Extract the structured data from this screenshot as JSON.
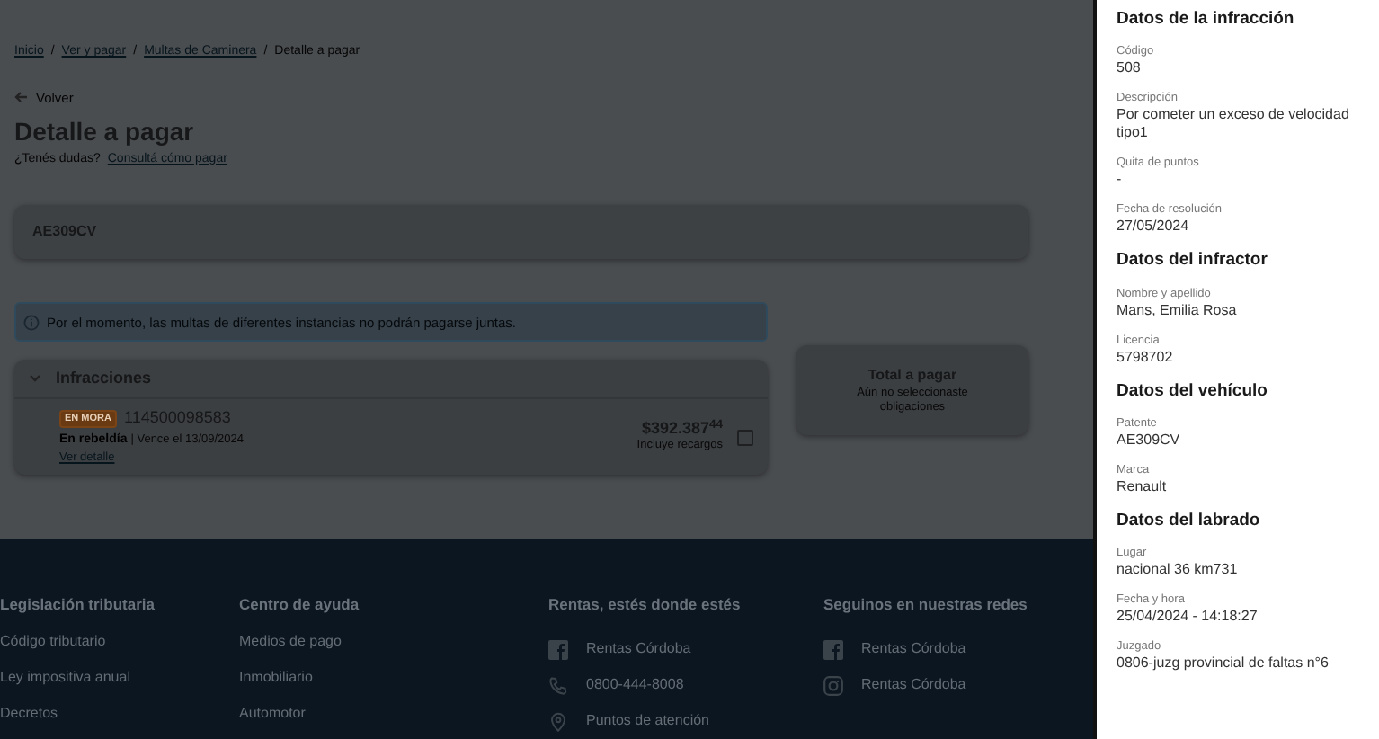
{
  "breadcrumb": [
    {
      "label": "Inicio",
      "kind": "link"
    },
    {
      "label": "/",
      "kind": "separator"
    },
    {
      "label": "Ver y pagar",
      "kind": "link"
    },
    {
      "label": "/",
      "kind": "separator"
    },
    {
      "label": "Multas de Caminera",
      "kind": "link"
    },
    {
      "label": "/",
      "kind": "separator"
    },
    {
      "label": "Detalle a pagar",
      "kind": "current"
    }
  ],
  "back": "Volver",
  "title": "Detalle a pagar",
  "help": {
    "text": "¿Tenés dudas?",
    "link": "Consultá cómo pagar"
  },
  "plate": "AE309CV",
  "notice": "Por el momento, las multas de diferentes instancias no podrán pagarse juntas.",
  "infracciones": {
    "title": "Infracciones",
    "expanded": true,
    "items": [
      {
        "badge": "EN MORA",
        "number": "114500098583",
        "status": "En rebeldía",
        "due": "| Vence el 13/09/2024",
        "link": "Ver detalle",
        "amount": "$392.387$^{44}$",
        "note": "Incluye recargos",
        "checked": false
      }
    ]
  },
  "total": {
    "title": "Total a pagar",
    "note": "Aún no seleccionaste obligaciones"
  },
  "footer": [
    {
      "title": "Legislación tributaria",
      "items": [
        {
          "kind": "text",
          "label": "Código tributario"
        },
        {
          "kind": "text",
          "label": "Ley impositiva anual"
        },
        {
          "kind": "text",
          "label": "Decretos"
        }
      ]
    },
    {
      "title": "Centro de ayuda",
      "items": [
        {
          "kind": "text",
          "label": "Medios de pago"
        },
        {
          "kind": "text",
          "label": "Inmobiliario"
        },
        {
          "kind": "text",
          "label": "Automotor"
        }
      ]
    },
    {
      "title": "Rentas, estés donde estés",
      "items": [
        {
          "kind": "facebook",
          "label": "Rentas Córdoba"
        },
        {
          "kind": "phone",
          "label": "0800-444-8008"
        },
        {
          "kind": "location",
          "label": "Puntos de atención"
        }
      ]
    },
    {
      "title": "Seguinos en nuestras redes",
      "items": [
        {
          "kind": "facebook",
          "label": "Rentas Córdoba"
        },
        {
          "kind": "instagram",
          "label": "Rentas Córdoba"
        }
      ]
    }
  ],
  "drawer": [
    {
      "title": "Datos de la infracción",
      "fields": [
        {
          "label": "Código",
          "value": "508"
        },
        {
          "label": "Descripción",
          "value": "Por cometer un exceso de velocidad tipo1"
        },
        {
          "label": "Quita de puntos",
          "value": "-"
        },
        {
          "label": "Fecha de resolución",
          "value": "27/05/2024"
        }
      ]
    },
    {
      "title": "Datos del infractor",
      "fields": [
        {
          "label": "Nombre y apellido",
          "value": "Mans, Emilia Rosa"
        },
        {
          "label": "Licencia",
          "value": "5798702"
        }
      ]
    },
    {
      "title": "Datos del vehículo",
      "fields": [
        {
          "label": "Patente",
          "value": "AE309CV"
        },
        {
          "label": "Marca",
          "value": "Renault"
        }
      ]
    },
    {
      "title": "Datos del labrado",
      "fields": [
        {
          "label": "Lugar",
          "value": "nacional 36 km731"
        },
        {
          "label": "Fecha y hora",
          "value": "25/04/2024 - 14:18:27"
        },
        {
          "label": "Juzgado",
          "value": "0806-juzg provincial de faltas n°6"
        }
      ]
    }
  ]
}
